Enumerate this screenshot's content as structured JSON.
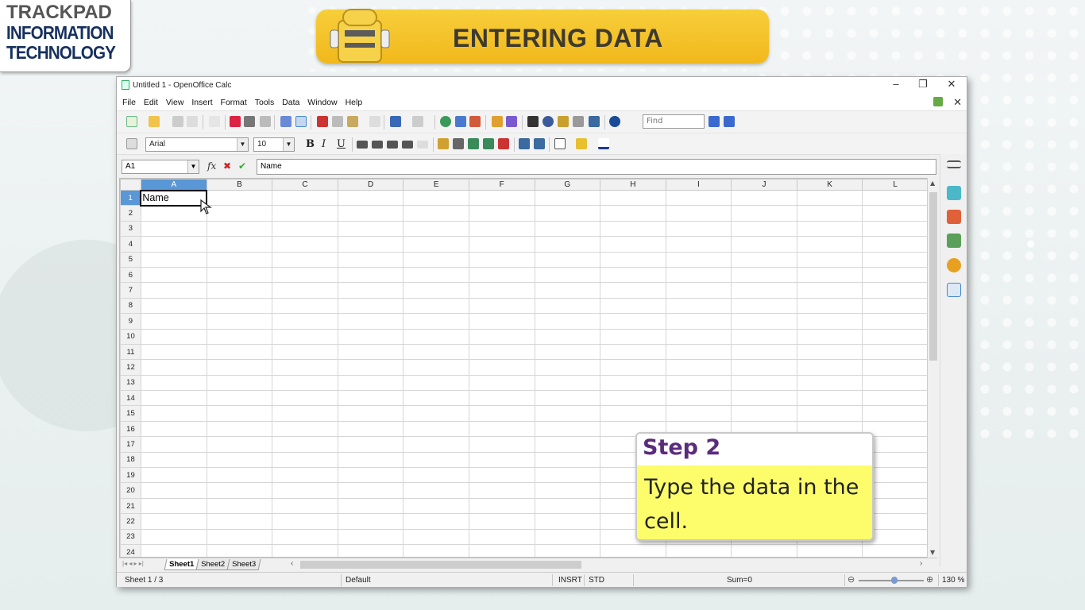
{
  "logo": {
    "line1": "TRACKPAD",
    "line2": "INFORMATION",
    "line3": "TECHNOLOGY"
  },
  "banner": {
    "title": "ENTERING DATA"
  },
  "window": {
    "title": "Untitled 1 - OpenOffice Calc",
    "controls": {
      "minimize": "–",
      "maximize": "❐",
      "close": "✕"
    }
  },
  "menu": [
    "File",
    "Edit",
    "View",
    "Insert",
    "Format",
    "Tools",
    "Data",
    "Window",
    "Help"
  ],
  "menu_close": "✕",
  "toolbar": {
    "find_placeholder": "Find"
  },
  "format": {
    "font_name": "Arial",
    "font_size": "10",
    "bold": "B",
    "italic": "I",
    "underline": "U"
  },
  "formula": {
    "cell_ref": "A1",
    "content": "Name",
    "fx": "fx",
    "cancel": "✖",
    "accept": "✔"
  },
  "grid": {
    "columns": [
      "A",
      "B",
      "C",
      "D",
      "E",
      "F",
      "G",
      "H",
      "I",
      "J",
      "K",
      "L"
    ],
    "rows": [
      "1",
      "2",
      "3",
      "4",
      "5",
      "6",
      "7",
      "8",
      "9",
      "10",
      "11",
      "12",
      "13",
      "14",
      "15",
      "16",
      "17",
      "18",
      "19",
      "20",
      "21",
      "22",
      "23",
      "24"
    ],
    "a1_value": "Name"
  },
  "tabs": [
    "Sheet1",
    "Sheet2",
    "Sheet3"
  ],
  "status": {
    "sheet": "Sheet 1 / 3",
    "style": "Default",
    "mode": "INSRT",
    "selection": "STD",
    "sum": "Sum=0",
    "zoom": "130 %"
  },
  "callout": {
    "title": "Step 2",
    "text": "Type the data in the cell."
  },
  "colors": {
    "banner": "#f5c42c",
    "callout_body": "#fdfd6c",
    "step_title": "#5b2b7c",
    "selection": "#5a97d6"
  }
}
